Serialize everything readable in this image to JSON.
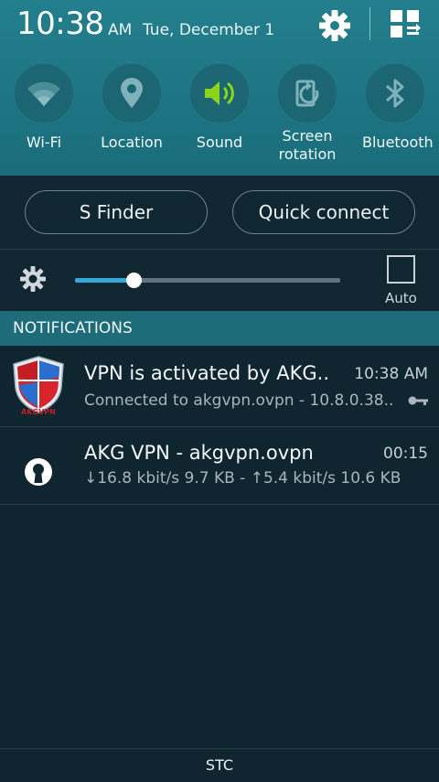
{
  "status": {
    "time": "10:38",
    "ampm": "AM",
    "date": "Tue, December 1"
  },
  "quick_settings": [
    {
      "label": "Wi-Fi",
      "icon": "wifi-icon",
      "active": false
    },
    {
      "label": "Location",
      "icon": "location-icon",
      "active": false
    },
    {
      "label": "Sound",
      "icon": "sound-icon",
      "active": true
    },
    {
      "label_line1": "Screen",
      "label_line2": "rotation",
      "icon": "screen-rotation-icon",
      "active": false
    },
    {
      "label": "Bluetooth",
      "icon": "bluetooth-icon",
      "active": false
    }
  ],
  "buttons": {
    "s_finder": "S Finder",
    "quick_connect": "Quick connect"
  },
  "brightness": {
    "level": 0.22,
    "auto_label": "Auto",
    "auto_checked": false
  },
  "notifications_header": "NOTIFICATIONS",
  "notifications": [
    {
      "title": "VPN is activated by AKG..",
      "time": "10:38 AM",
      "text": "Connected to akgvpn.ovpn - 10.8.0.38..",
      "icon": "akgvpn-shield-icon",
      "icon_text": "AKGVPN"
    },
    {
      "title": "AKG VPN - akgvpn.ovpn",
      "time": "00:15",
      "text": "↓16.8 kbit/s 9.7 KB - ↑5.4 kbit/s 10.6 KB",
      "icon": "openvpn-icon"
    }
  ],
  "carrier": "STC",
  "colors": {
    "accent_teal": "#237f8d",
    "sound_active": "#8bd41a",
    "slider_fill": "#36a8d6"
  }
}
